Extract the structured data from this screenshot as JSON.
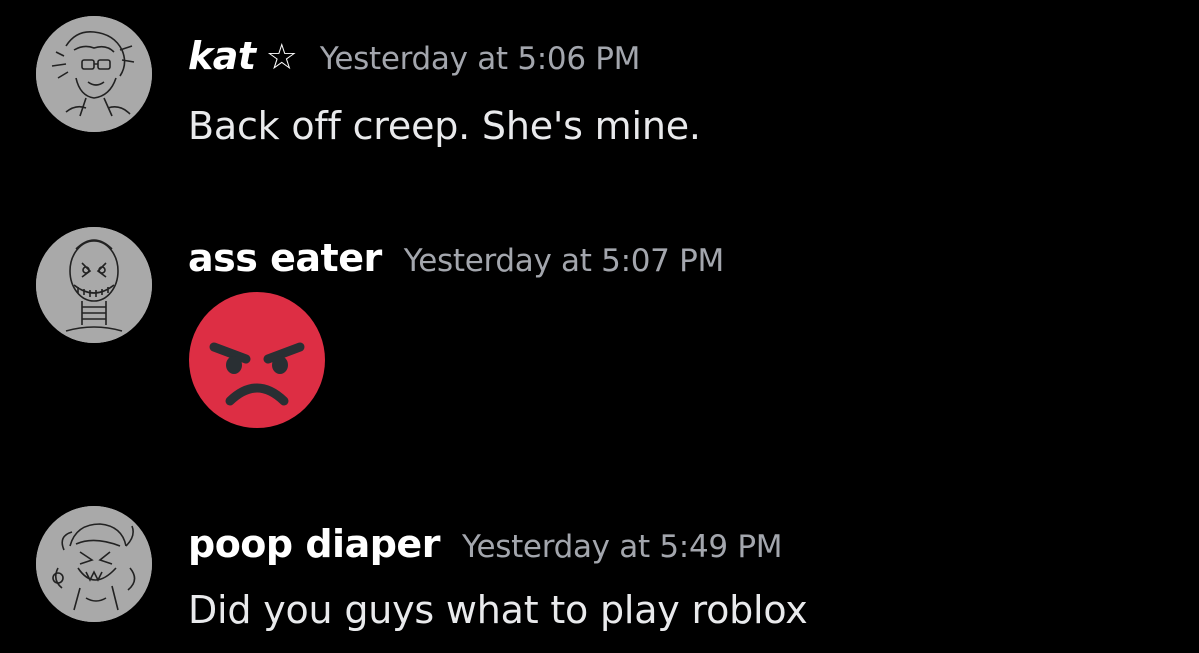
{
  "messages": [
    {
      "username": "kat",
      "badge_icon": "star-outline-icon",
      "badge_glyph": "☆",
      "timestamp": "Yesterday at 5:06 PM",
      "content": "Back off creep. She's mine."
    },
    {
      "username": "ass eater",
      "timestamp": "Yesterday at 5:07 PM",
      "content_emoji": "angry-face-emoji"
    },
    {
      "username": "poop diaper",
      "timestamp": "Yesterday at 5:49 PM",
      "content": "Did you guys what to play roblox"
    }
  ],
  "colors": {
    "background": "#000000",
    "username": "#ffffff",
    "timestamp": "#a3a6ad",
    "message_text": "#e9eaec",
    "avatar_bg": "#a9a9a9",
    "angry_emoji": "#dd2e44"
  }
}
